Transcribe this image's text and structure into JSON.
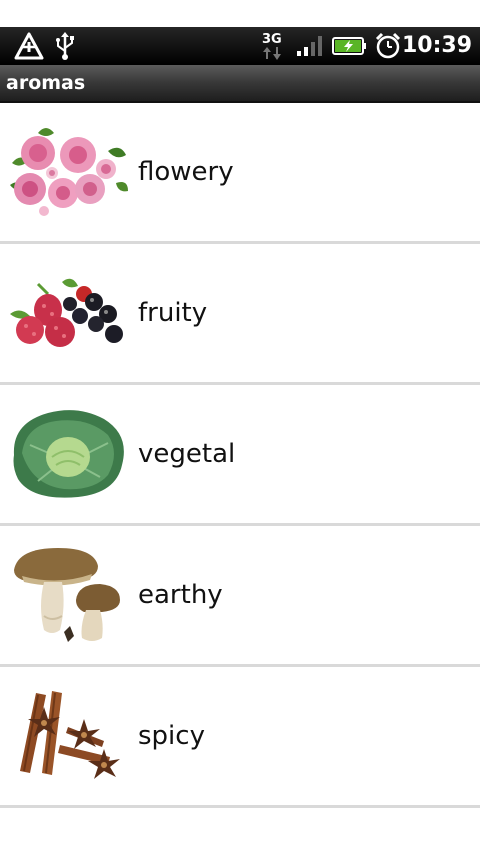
{
  "status_bar": {
    "time": "10:39",
    "network_type": "3G",
    "icons": [
      "warning-icon",
      "usb-icon",
      "3g-data-icon",
      "signal-icon",
      "battery-charging-icon",
      "alarm-clock-icon"
    ]
  },
  "title_bar": {
    "title": "aromas"
  },
  "aromas": [
    {
      "label": "flowery",
      "image": "roses-image"
    },
    {
      "label": "fruity",
      "image": "berries-image"
    },
    {
      "label": "vegetal",
      "image": "cabbage-image"
    },
    {
      "label": "earthy",
      "image": "mushrooms-image"
    },
    {
      "label": "spicy",
      "image": "cinnamon-star-anise-image"
    }
  ]
}
